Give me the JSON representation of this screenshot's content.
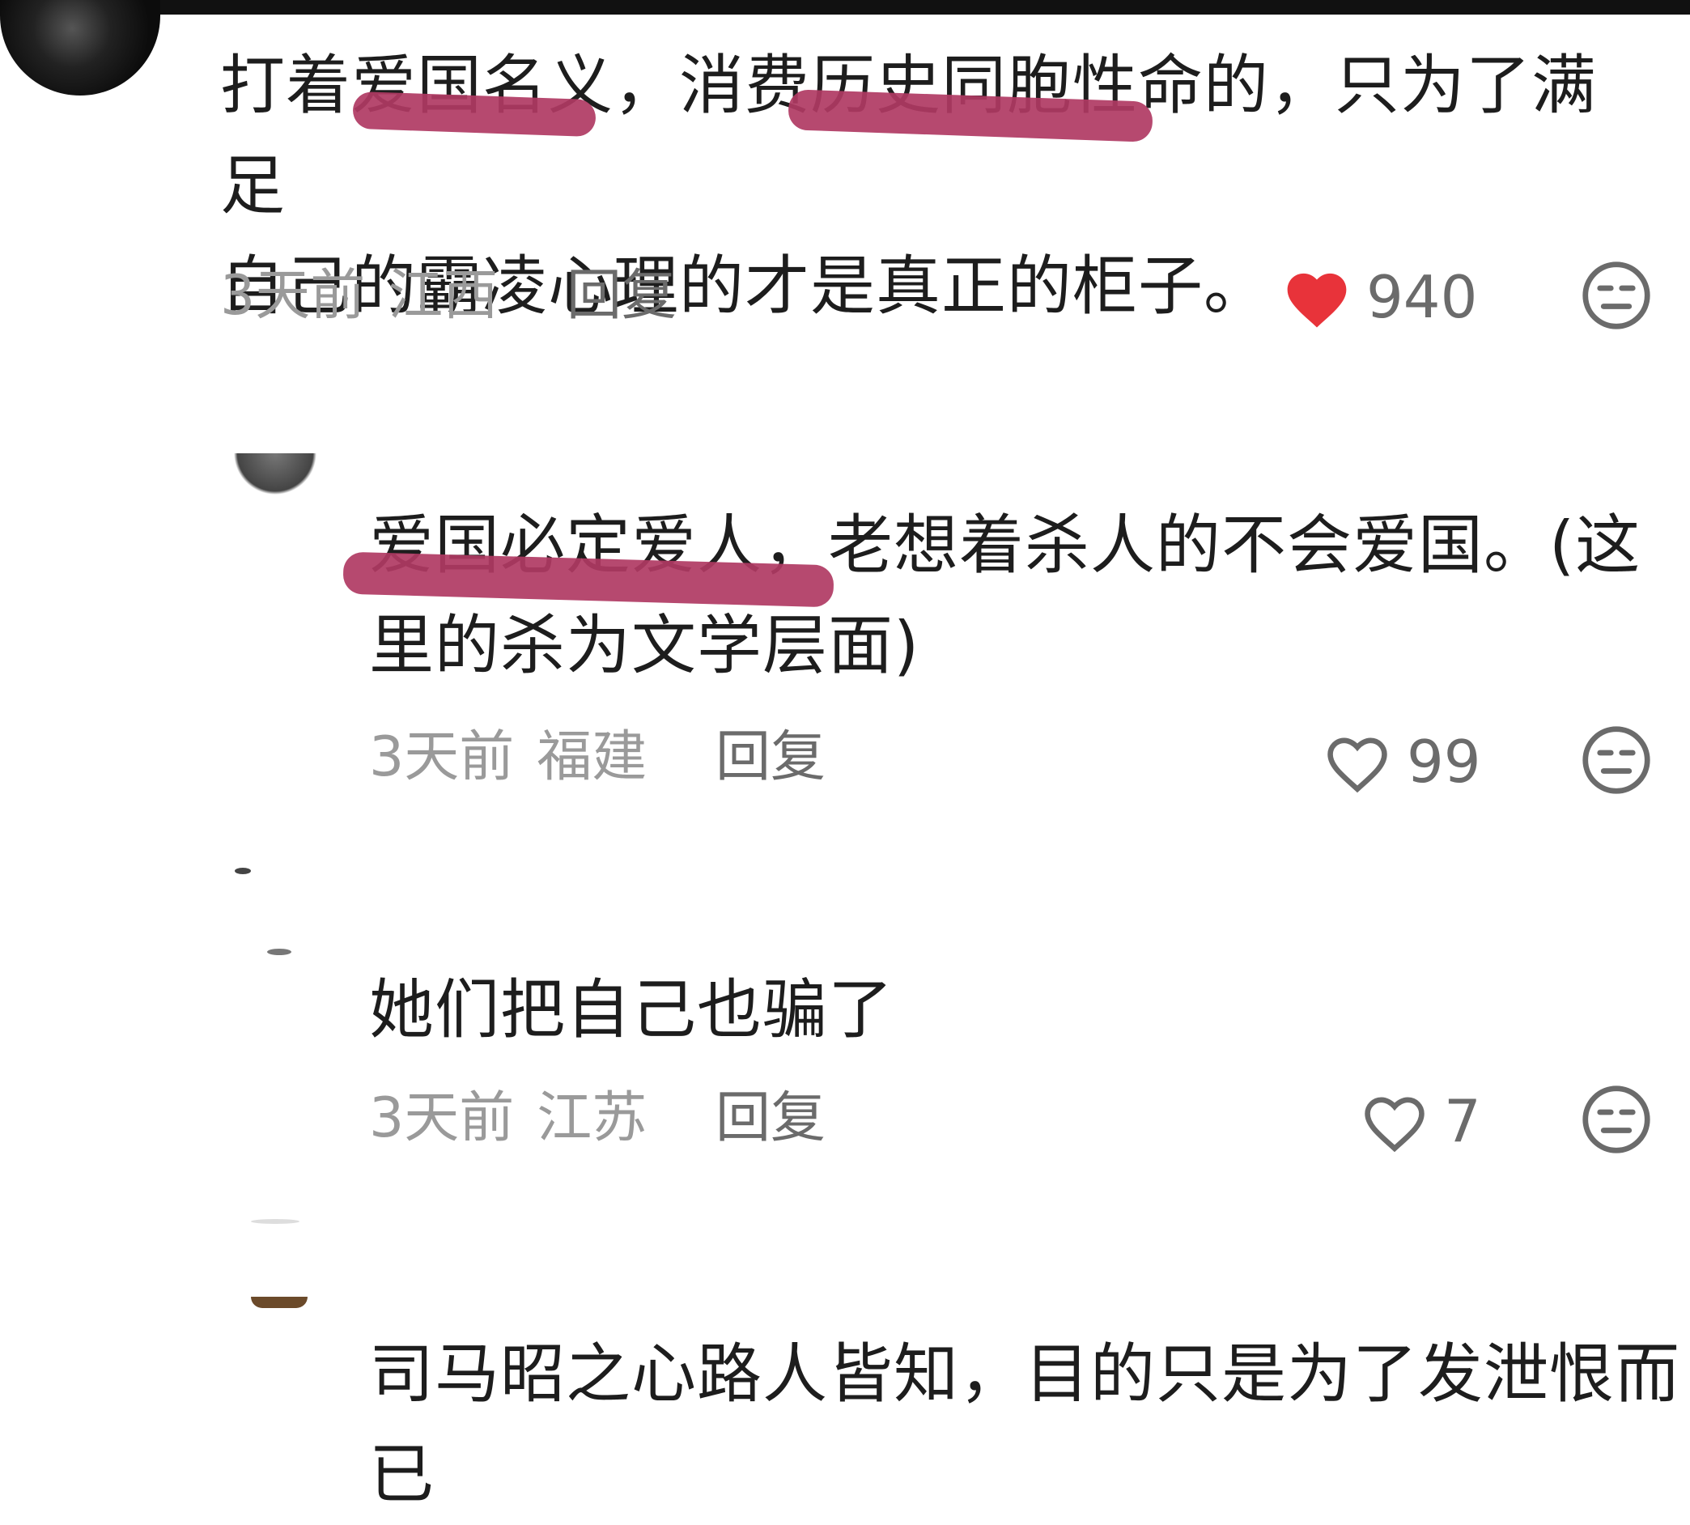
{
  "comments": [
    {
      "text": "打着爱国名义，消费历史同胞性命的，只为了满足\n自己的霸凌心理的才是真正的柜子。",
      "time": "3天前",
      "region": "江西",
      "reply_label": "回复",
      "likes": "940",
      "liked": true
    },
    {
      "text": "爱国必定爱人，老想着杀人的不会爱国。(这\n里的杀为文学层面)",
      "time": "3天前",
      "region": "福建",
      "reply_label": "回复",
      "likes": "99",
      "liked": false
    },
    {
      "text": "她们把自己也骗了",
      "time": "3天前",
      "region": "江苏",
      "reply_label": "回复",
      "likes": "7",
      "liked": false
    },
    {
      "text": "司马昭之心路人皆知，目的只是为了发泄恨而\n已"
    }
  ],
  "colors": {
    "like_active": "#e8333a",
    "like_inactive": "#6b6b6b",
    "highlight_mark": "#b03a63"
  },
  "icons": {
    "like": "heart-icon",
    "dislike": "meh-face-icon"
  }
}
